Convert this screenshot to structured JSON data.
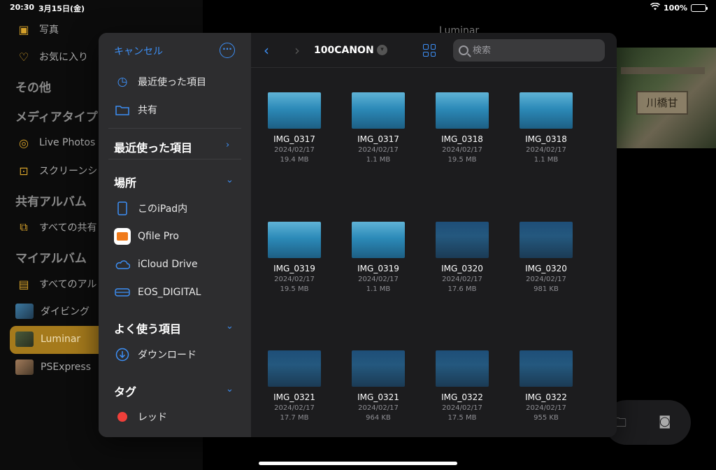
{
  "status": {
    "time": "20:30",
    "date": "3月15日(金)",
    "battery": "100%"
  },
  "bg_sidebar": {
    "items": [
      {
        "label": "写真"
      },
      {
        "label": "お気に入り"
      }
    ],
    "section_other": "その他",
    "section_media": "メディアタイプ",
    "live_photos": "Live Photos",
    "screenshots": "スクリーンシ",
    "section_shared": "共有アルバム",
    "all_shared": "すべての共有",
    "section_my": "マイアルバム",
    "all_albums": "すべてのアル",
    "diving": "ダイビング",
    "luminar": "Luminar",
    "psexpress": "PSExpress"
  },
  "bg_main": {
    "title": "Luminar",
    "photo_sign": "川橋甘"
  },
  "picker": {
    "cancel": "キャンセル",
    "recents": "最近使った項目",
    "shared": "共有",
    "section_recent": "最近使った項目",
    "section_locations": "場所",
    "on_ipad": "このiPad内",
    "qfile": "Qfile Pro",
    "icloud": "iCloud Drive",
    "eos": "EOS_DIGITAL",
    "section_favorites": "よく使う項目",
    "downloads": "ダウンロード",
    "section_tags": "タグ",
    "tag_red": "レッド",
    "folder": "100CANON",
    "search_placeholder": "検索",
    "files": [
      {
        "name": "IMG_0317",
        "date": "2024/02/17",
        "size": "19.4 MB"
      },
      {
        "name": "IMG_0317",
        "date": "2024/02/17",
        "size": "1.1 MB"
      },
      {
        "name": "IMG_0318",
        "date": "2024/02/17",
        "size": "19.5 MB"
      },
      {
        "name": "IMG_0318",
        "date": "2024/02/17",
        "size": "1.1 MB"
      },
      {
        "name": "IMG_0319",
        "date": "2024/02/17",
        "size": "19.5 MB"
      },
      {
        "name": "IMG_0319",
        "date": "2024/02/17",
        "size": "1.1 MB"
      },
      {
        "name": "IMG_0320",
        "date": "2024/02/17",
        "size": "17.6 MB"
      },
      {
        "name": "IMG_0320",
        "date": "2024/02/17",
        "size": "981 KB"
      },
      {
        "name": "IMG_0321",
        "date": "2024/02/17",
        "size": "17.7 MB"
      },
      {
        "name": "IMG_0321",
        "date": "2024/02/17",
        "size": "964 KB"
      },
      {
        "name": "IMG_0322",
        "date": "2024/02/17",
        "size": "17.5 MB"
      },
      {
        "name": "IMG_0322",
        "date": "2024/02/17",
        "size": "955 KB"
      }
    ]
  },
  "colors": {
    "accent": "#3d8ff5",
    "photos_accent": "#d4a02a",
    "tag_red": "#ef3f3a"
  }
}
